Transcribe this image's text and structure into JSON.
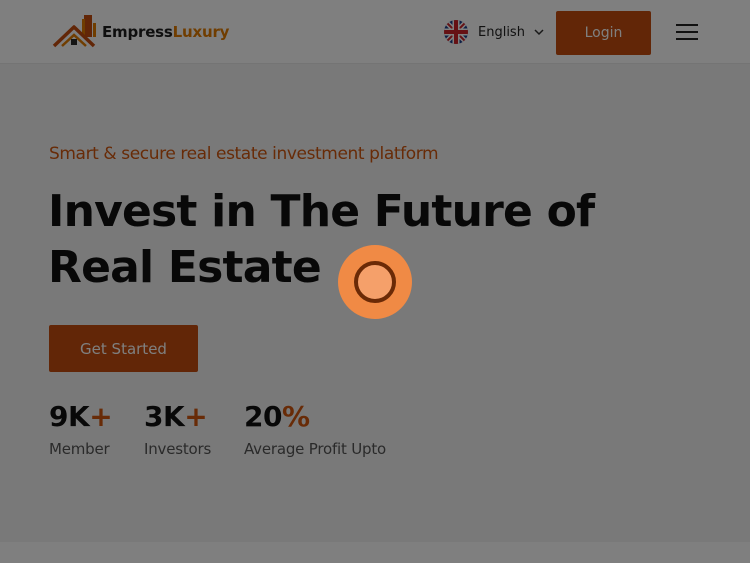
{
  "brand": {
    "name_part1": "Empress",
    "name_part2": "Luxury",
    "accent": "#e07b00"
  },
  "header": {
    "language": {
      "flag_icon": "uk-flag-icon",
      "label": "English",
      "chevron_icon": "chevron-down-icon"
    },
    "login_label": "Login",
    "menu_icon": "hamburger-menu-icon"
  },
  "hero": {
    "tagline": "Smart & secure real estate investment platform",
    "headline": "Invest in The Future of Real Estate",
    "cta_label": "Get Started",
    "stats": [
      {
        "value": "9K",
        "suffix": "+",
        "label": "Member"
      },
      {
        "value": "3K",
        "suffix": "+",
        "label": "Investors"
      },
      {
        "value": "20",
        "suffix": "%",
        "label": "Average Profit Upto"
      }
    ]
  },
  "overlay": {
    "loader_icon": "loading-spinner-icon"
  },
  "colors": {
    "primary": "#c44d0e",
    "accent": "#d0570f",
    "overlay": "rgba(0,0,0,0.5)"
  }
}
